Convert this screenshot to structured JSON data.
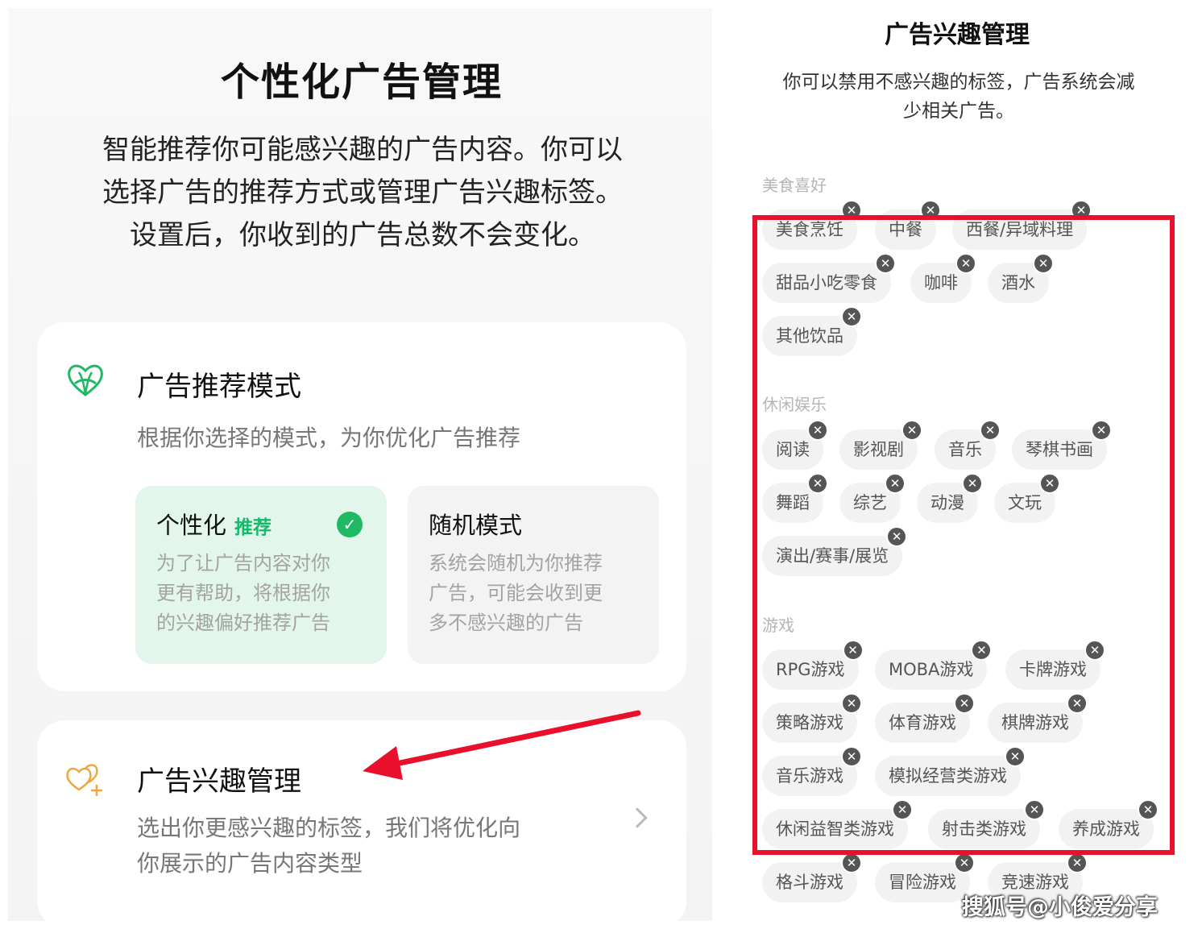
{
  "left": {
    "title": "个性化广告管理",
    "intro_lines": [
      "智能推荐你可能感兴趣的广告内容。你可以",
      "选择广告的推荐方式或管理广告兴趣标签。",
      "设置后，你收到的广告总数不会变化。"
    ],
    "recommend_card": {
      "icon": "heart-outline-icon",
      "title": "广告推荐模式",
      "description": "根据你选择的模式，为你优化广告推荐",
      "modes": [
        {
          "name": "个性化",
          "tag": "推荐",
          "selected": true,
          "desc_lines": [
            "为了让广告内容对你",
            "更有帮助，将根据你",
            "的兴趣偏好推荐广告"
          ]
        },
        {
          "name": "随机模式",
          "tag": "",
          "selected": false,
          "desc_lines": [
            "系统会随机为你推荐",
            "广告，可能会收到更",
            "多不感兴趣的广告"
          ]
        }
      ]
    },
    "interest_card": {
      "icon": "hearts-plus-icon",
      "title": "广告兴趣管理",
      "description_lines": [
        "选出你更感兴趣的标签，我们将优化向",
        "你展示的广告内容类型"
      ]
    }
  },
  "right": {
    "title": "广告兴趣管理",
    "intro_lines": [
      "你可以禁用不感兴趣的标签，广告系统会减",
      "少相关广告。"
    ],
    "sections": [
      {
        "label": "美食喜好",
        "tags": [
          "美食烹饪",
          "中餐",
          "西餐/异域料理",
          "甜品小吃零食",
          "咖啡",
          "酒水",
          "其他饮品"
        ]
      },
      {
        "label": "休闲娱乐",
        "tags": [
          "阅读",
          "影视剧",
          "音乐",
          "琴棋书画",
          "舞蹈",
          "综艺",
          "动漫",
          "文玩",
          "演出/赛事/展览"
        ]
      },
      {
        "label": "游戏",
        "tags": [
          "RPG游戏",
          "MOBA游戏",
          "卡牌游戏",
          "策略游戏",
          "体育游戏",
          "棋牌游戏",
          "音乐游戏",
          "模拟经营类游戏",
          "休闲益智类游戏",
          "射击类游戏",
          "养成游戏",
          "格斗游戏",
          "冒险游戏",
          "竞速游戏"
        ]
      }
    ]
  },
  "watermark": "搜狐号@小俊爱分享",
  "colors": {
    "accent_green": "#1fb865",
    "annotation_red": "#e8102a",
    "icon_orange": "#f0a640"
  }
}
